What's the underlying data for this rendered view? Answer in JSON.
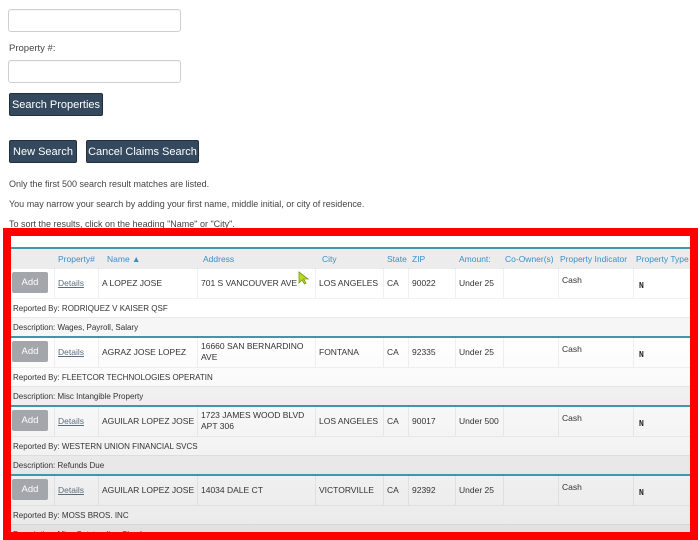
{
  "form": {
    "first_input_value": "",
    "property_label": "Property #:",
    "property_input_value": "",
    "search_button": "Search Properties",
    "new_search_button": "New Search",
    "cancel_button": "Cancel Claims Search"
  },
  "notes": [
    "Only the first 500 search result matches are listed.",
    "You may narrow your search by adding your first name, middle initial, or city of residence.",
    "To sort the results, click on the heading \"Name\" or \"City\"."
  ],
  "highlight_color": "#ff0000",
  "accent_color": "#3e98a8",
  "table": {
    "headers": {
      "property": "Property#",
      "name": "Name ▲",
      "address": "Address",
      "city": "City",
      "state": "State",
      "zip": "ZIP",
      "amount": "Amount:",
      "coowner": "Co-Owner(s)",
      "indicator": "Property Indicator",
      "type": "Property Type"
    },
    "add_label": "Add",
    "details_label": "Details",
    "rows": [
      {
        "name": "A LOPEZ JOSE",
        "address": "701 S VANCOUVER AVE",
        "city": "LOS ANGELES",
        "state": "CA",
        "zip": "90022",
        "amount": "Under 25",
        "coowner": "",
        "indicator": "Cash",
        "type": "N",
        "reported_by": "Reported By: RODRIQUEZ V KAISER QSF",
        "description": "Description: Wages, Payroll, Salary"
      },
      {
        "name": "AGRAZ JOSE LOPEZ",
        "address": "16660 SAN BERNARDINO AVE",
        "city": "FONTANA",
        "state": "CA",
        "zip": "92335",
        "amount": "Under 25",
        "coowner": "",
        "indicator": "Cash",
        "type": "N",
        "reported_by": "Reported By: FLEETCOR TECHNOLOGIES OPERATIN",
        "description": "Description: Misc Intangible Property"
      },
      {
        "name": "AGUILAR LOPEZ JOSE",
        "address": "1723 JAMES WOOD BLVD APT 306",
        "city": "LOS ANGELES",
        "state": "CA",
        "zip": "90017",
        "amount": "Under 500",
        "coowner": "",
        "indicator": "Cash",
        "type": "N",
        "reported_by": "Reported By: WESTERN UNION FINANCIAL SVCS",
        "description": "Description: Refunds Due"
      },
      {
        "name": "AGUILAR LOPEZ JOSE",
        "address": "14034 DALE CT",
        "city": "VICTORVILLE",
        "state": "CA",
        "zip": "92392",
        "amount": "Under 25",
        "coowner": "",
        "indicator": "Cash",
        "type": "N",
        "reported_by": "Reported By: MOSS BROS. INC",
        "description": "Description: Misc Outstanding Checks"
      }
    ]
  }
}
